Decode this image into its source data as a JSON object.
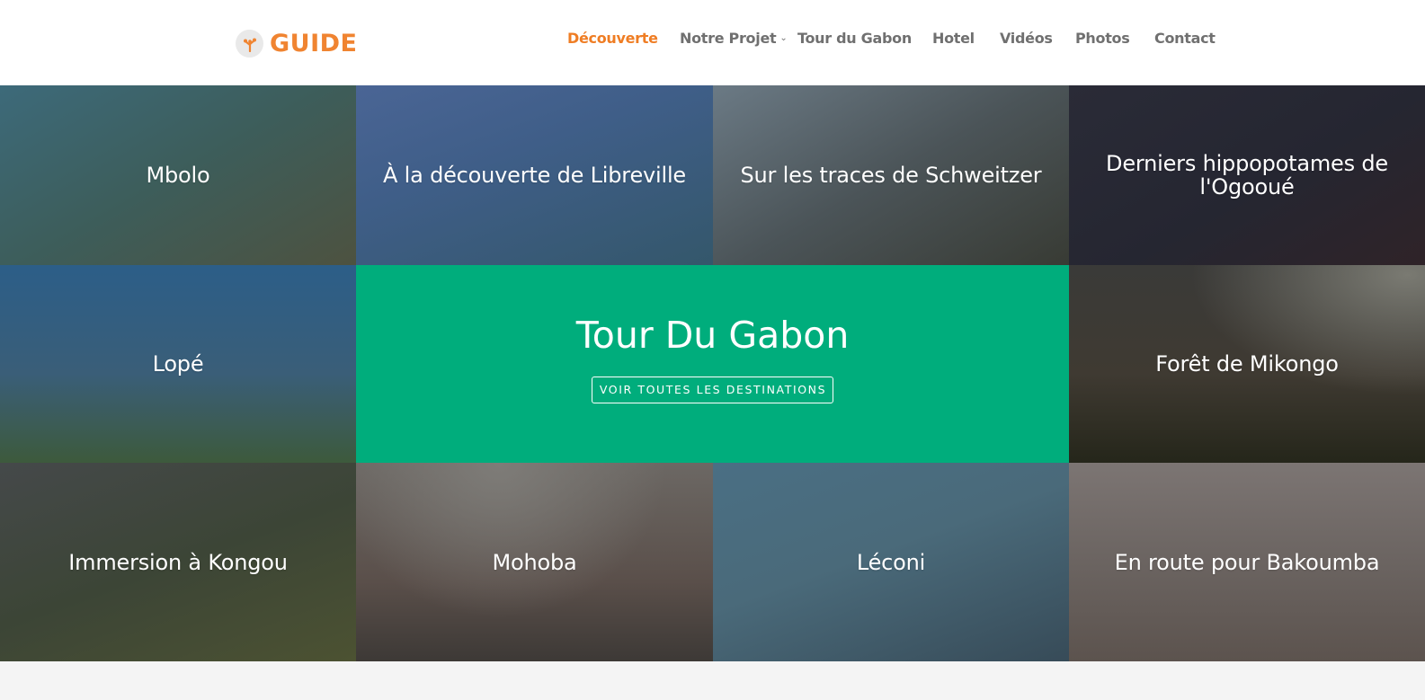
{
  "header": {
    "logo_text": "GUIDE",
    "logo_icon": "tree-branch-icon",
    "accent_color": "#ef7d24"
  },
  "nav": {
    "items": [
      {
        "label": "Découverte",
        "active": true
      },
      {
        "label": "Notre Projet",
        "has_dropdown": true
      },
      {
        "label": "Tour du Gabon"
      },
      {
        "label": "Hotel"
      },
      {
        "label": "Vidéos"
      },
      {
        "label": "Photos"
      },
      {
        "label": "Contact"
      }
    ],
    "dropdown_icon": "chevron-down-icon"
  },
  "tiles": [
    {
      "title": "Mbolo"
    },
    {
      "title": "À la découverte de Libreville"
    },
    {
      "title": "Sur les traces de Schweitzer"
    },
    {
      "title": "Derniers hippopotames de l'Ogooué"
    },
    {
      "title": "Lopé"
    },
    {
      "title": "Forêt de Mikongo"
    },
    {
      "title": "Immersion à Kongou"
    },
    {
      "title": "Mohoba"
    },
    {
      "title": "Léconi"
    },
    {
      "title": "En route pour Bakoumba"
    }
  ],
  "feature": {
    "title": "Tour Du Gabon",
    "button_label": "VOIR TOUTES LES DESTINATIONS",
    "bg_color": "#00ad7c"
  }
}
